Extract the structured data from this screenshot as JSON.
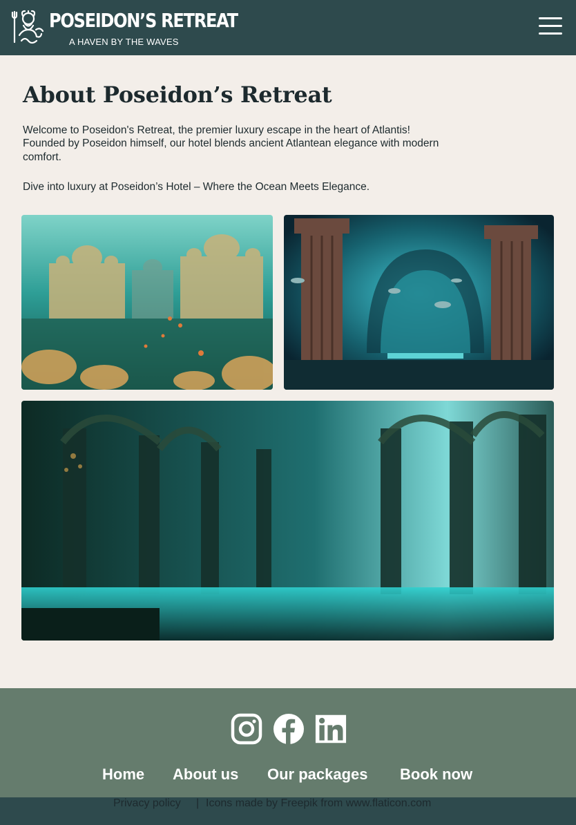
{
  "header": {
    "brand_title": "POSEIDON’S RETREAT",
    "brand_tagline": "A HAVEN BY THE WAVES",
    "logo_icon": "poseidon-trident-icon",
    "menu_icon": "hamburger-menu-icon"
  },
  "main": {
    "title": "About Poseidon’s Retreat",
    "intro": "Welcome to Poseidon's Retreat, the premier luxury escape in the heart of Atlantis! Founded by Poseidon himself, our hotel blends ancient Atlantean elegance with modern comfort.",
    "tagline": "Dive into luxury at Poseidon’s Hotel – Where the Ocean Meets Elegance."
  },
  "footer": {
    "social_icons": [
      "instagram-icon",
      "facebook-icon",
      "linkedin-icon"
    ],
    "nav": {
      "home": "Home",
      "about": "About us",
      "packages": "Our packages",
      "book": "Book now"
    },
    "privacy": "Privacy policy",
    "separator": "|",
    "credits": "Icons made by Freepik from www.flaticon.com"
  },
  "colors": {
    "header_bg": "#2e4a4d",
    "page_bg": "#f3eee9",
    "footer_bg": "#657c6d",
    "text": "#1d2a2e"
  }
}
